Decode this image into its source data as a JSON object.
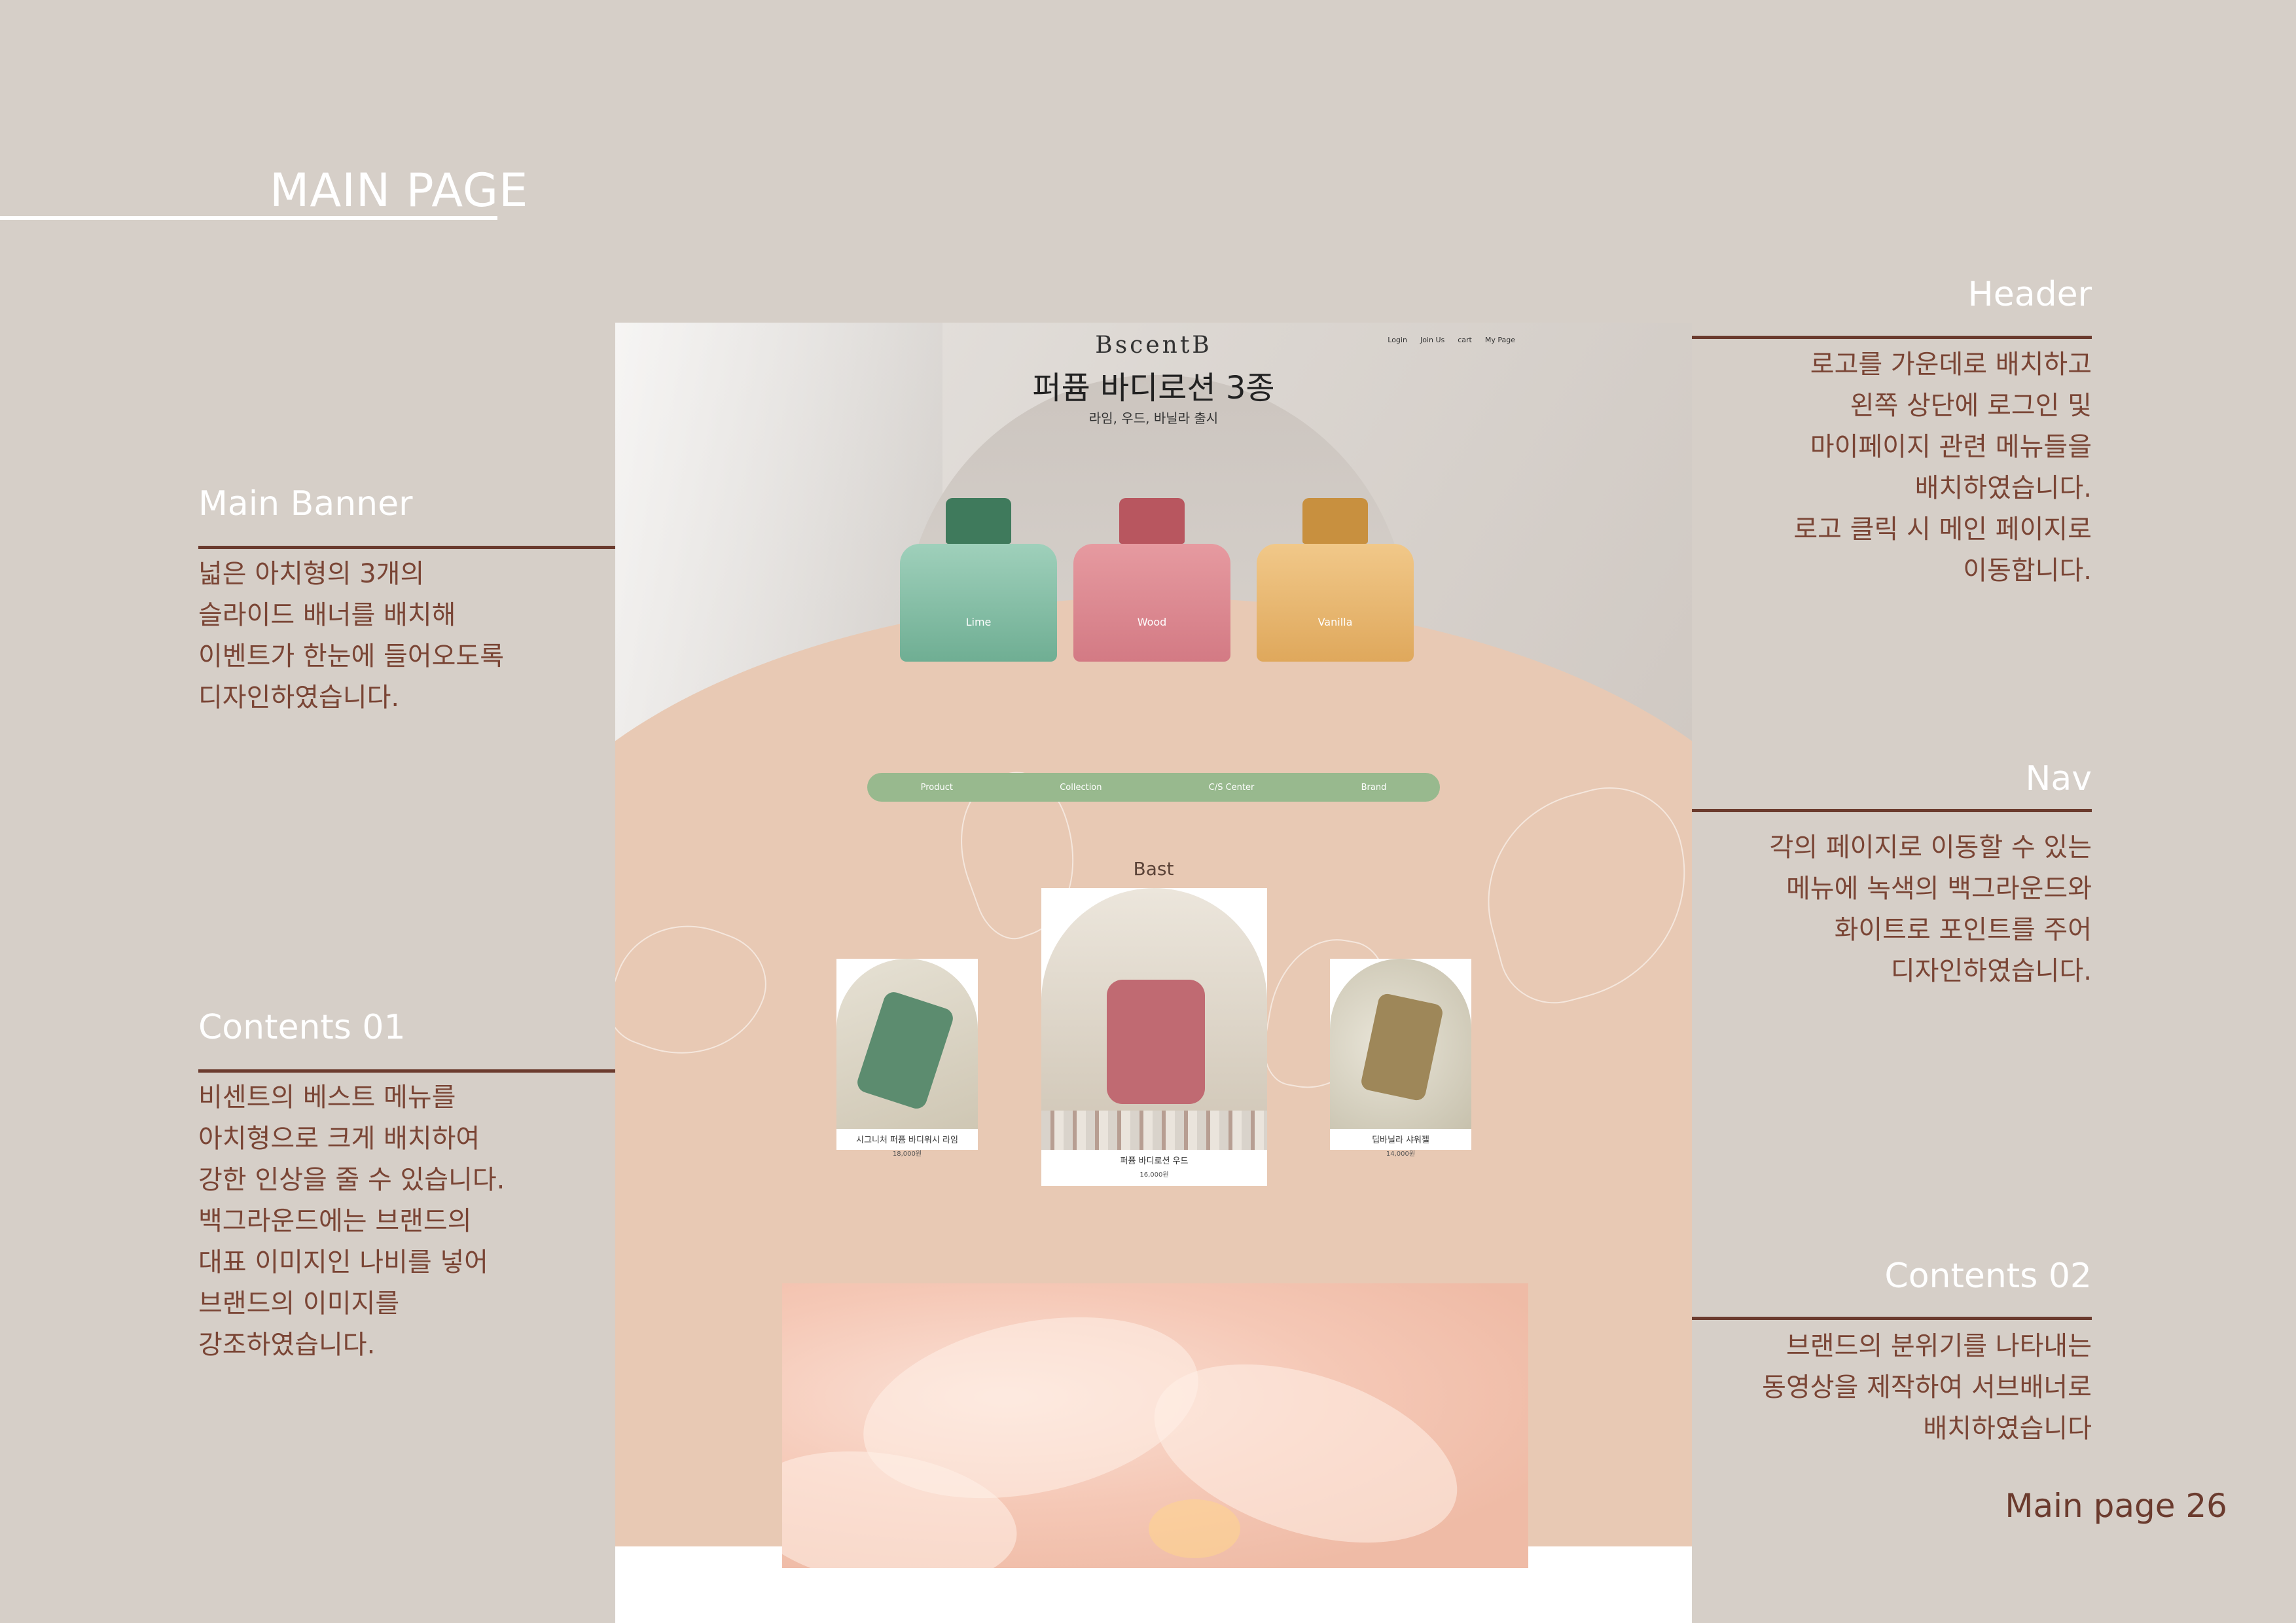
{
  "page": {
    "title": "MAIN PAGE",
    "page_number": "Main page 26"
  },
  "annotations": {
    "main_banner": {
      "title": "Main Banner",
      "body": "넓은 아치형의 3개의\n슬라이드 배너를 배치해\n이벤트가 한눈에 들어오도록\n디자인하였습니다."
    },
    "contents01": {
      "title": "Contents 01",
      "body": "비센트의 베스트 메뉴를\n아치형으로 크게 배치하여\n강한 인상을 줄 수 있습니다.\n백그라운드에는 브랜드의\n대표 이미지인 나비를 넣어\n브랜드의 이미지를\n강조하였습니다."
    },
    "header": {
      "title": "Header",
      "body": "로고를 가운데로 배치하고\n왼쪽 상단에 로그인 및\n마이페이지 관련 메뉴들을\n배치하였습니다.\n로고 클릭 시 메인 페이지로\n이동합니다."
    },
    "nav": {
      "title": "Nav",
      "body": "각의 페이지로 이동할 수 있는\n메뉴에 녹색의 백그라운드와\n화이트로 포인트를 주어\n디자인하였습니다."
    },
    "contents02": {
      "title": "Contents 02",
      "body": "브랜드의 분위기를 나타내는\n동영상을 제작하여 서브배너로\n배치하였습니다"
    }
  },
  "mockup": {
    "logo": "BscentB",
    "top_links": [
      "Login",
      "Join Us",
      "cart",
      "My Page"
    ],
    "banner_title": "퍼퓸 바디로션 3종",
    "banner_subtitle": "라임, 우드, 바닐라 출시",
    "bottles": [
      {
        "label": "Lime",
        "color": "#3f7a5c"
      },
      {
        "label": "Wood",
        "color": "#b8565f"
      },
      {
        "label": "Vanilla",
        "color": "#c8903f"
      }
    ],
    "nav": [
      "Product",
      "Collection",
      "C/S Center",
      "Brand"
    ],
    "best_title": "Bast",
    "products": [
      {
        "name": "시그니처 퍼퓸 바디워시 라임",
        "price": "18,000원"
      },
      {
        "name": "퍼퓸 바디로션 우드",
        "price": "16,000원"
      },
      {
        "name": "딥바닐라 샤워젤",
        "price": "14,000원"
      }
    ]
  },
  "colors": {
    "background": "#d6cfc8",
    "accent_brown": "#6b3b2e",
    "peach": "#e8c9b4",
    "nav_green": "#98b98e"
  }
}
